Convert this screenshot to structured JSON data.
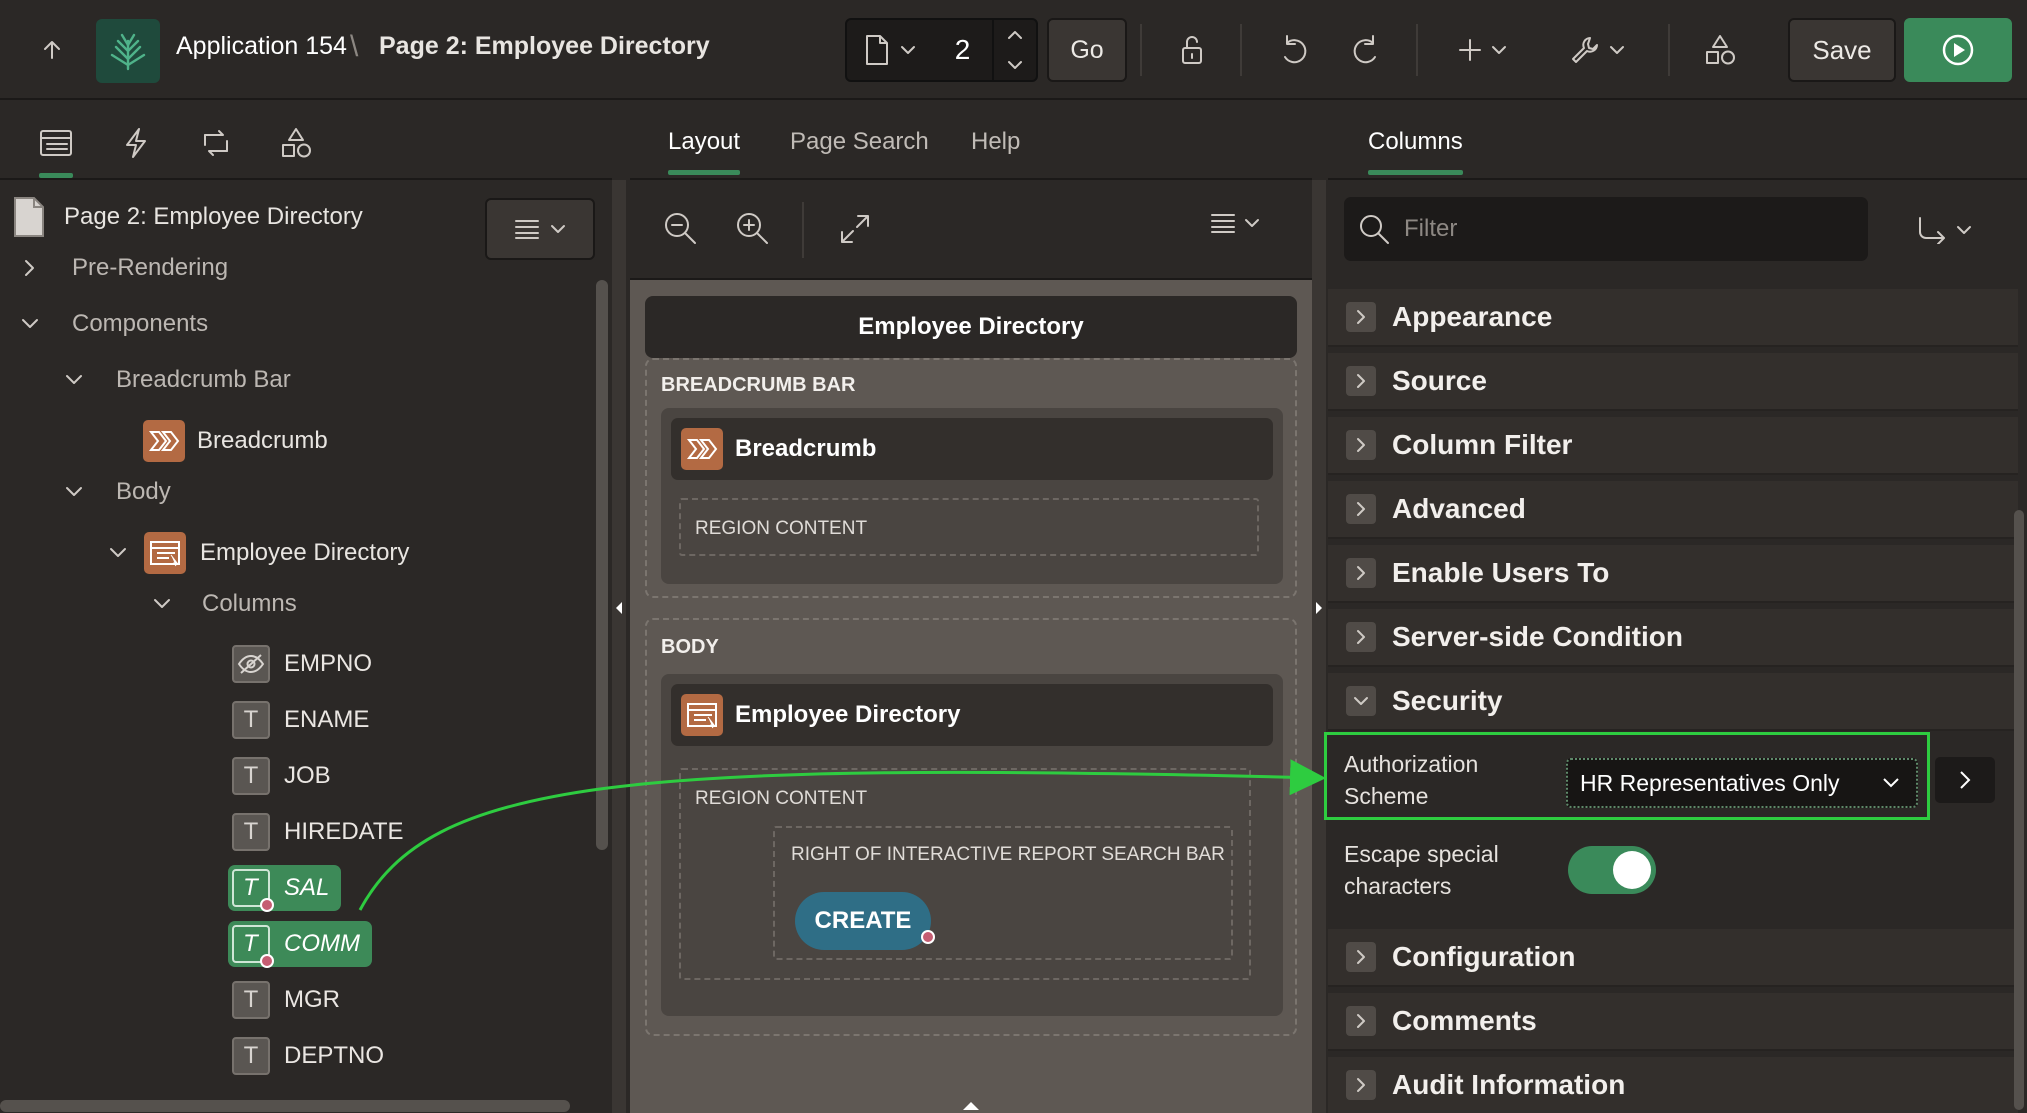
{
  "header": {
    "app_title": "Application 154",
    "breadcrumb_separator": "\\",
    "page_title": "Page 2: Employee Directory",
    "page_number": "2",
    "go_label": "Go",
    "save_label": "Save"
  },
  "left": {
    "page_node": "Page 2: Employee Directory",
    "tree": {
      "pre_rendering": "Pre-Rendering",
      "components": "Components",
      "breadcrumb_bar": "Breadcrumb Bar",
      "breadcrumb": "Breadcrumb",
      "body": "Body",
      "employee_directory": "Employee Directory",
      "columns": "Columns"
    },
    "columns": [
      "EMPNO",
      "ENAME",
      "JOB",
      "HIREDATE",
      "SAL",
      "COMM",
      "MGR",
      "DEPTNO"
    ],
    "selected_columns": [
      "SAL",
      "COMM"
    ]
  },
  "center": {
    "tabs": [
      "Layout",
      "Page Search",
      "Help"
    ],
    "active_tab": "Layout",
    "canvas": {
      "page_region_title": "Employee Directory",
      "breadcrumb_bar_label": "BREADCRUMB BAR",
      "breadcrumb_region": "Breadcrumb",
      "region_content": "REGION CONTENT",
      "body_label": "BODY",
      "report_region": "Employee Directory",
      "report_region_content": "REGION CONTENT",
      "right_of_search_bar": "RIGHT OF INTERACTIVE REPORT SEARCH BAR",
      "create_button": "CREATE"
    }
  },
  "right": {
    "tab": "Columns",
    "filter_placeholder": "Filter",
    "sections": {
      "appearance": "Appearance",
      "source": "Source",
      "column_filter": "Column Filter",
      "advanced": "Advanced",
      "enable_users_to": "Enable Users To",
      "server_side_condition": "Server-side Condition",
      "security": "Security",
      "configuration": "Configuration",
      "comments": "Comments",
      "audit_information": "Audit Information"
    },
    "security": {
      "auth_label_line1": "Authorization",
      "auth_label_line2": "Scheme",
      "auth_value": "HR Representatives Only",
      "escape_label_line1": "Escape special",
      "escape_label_line2": "characters",
      "escape_enabled": true
    }
  },
  "colors": {
    "accent_green": "#3a8a5a",
    "highlight_green": "#2ecc40",
    "component_orange": "#b36a43",
    "create_button_blue": "#2f6e86"
  }
}
